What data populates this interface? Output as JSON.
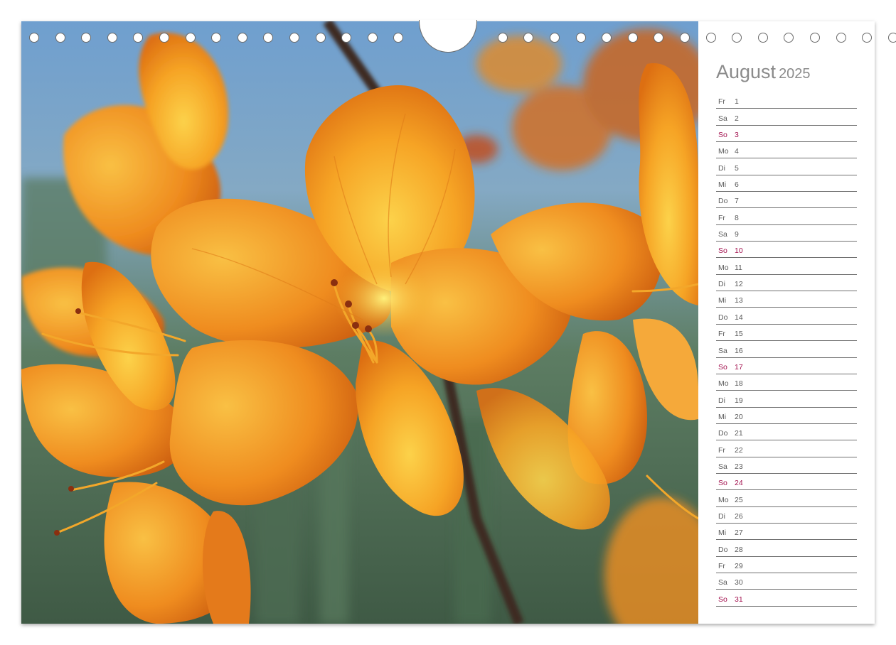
{
  "calendar": {
    "month": "August",
    "year": "2025",
    "days": [
      {
        "weekday": "Fr",
        "day": "1",
        "sunday": false
      },
      {
        "weekday": "Sa",
        "day": "2",
        "sunday": false
      },
      {
        "weekday": "So",
        "day": "3",
        "sunday": true
      },
      {
        "weekday": "Mo",
        "day": "4",
        "sunday": false
      },
      {
        "weekday": "Di",
        "day": "5",
        "sunday": false
      },
      {
        "weekday": "Mi",
        "day": "6",
        "sunday": false
      },
      {
        "weekday": "Do",
        "day": "7",
        "sunday": false
      },
      {
        "weekday": "Fr",
        "day": "8",
        "sunday": false
      },
      {
        "weekday": "Sa",
        "day": "9",
        "sunday": false
      },
      {
        "weekday": "So",
        "day": "10",
        "sunday": true
      },
      {
        "weekday": "Mo",
        "day": "11",
        "sunday": false
      },
      {
        "weekday": "Di",
        "day": "12",
        "sunday": false
      },
      {
        "weekday": "Mi",
        "day": "13",
        "sunday": false
      },
      {
        "weekday": "Do",
        "day": "14",
        "sunday": false
      },
      {
        "weekday": "Fr",
        "day": "15",
        "sunday": false
      },
      {
        "weekday": "Sa",
        "day": "16",
        "sunday": false
      },
      {
        "weekday": "So",
        "day": "17",
        "sunday": true
      },
      {
        "weekday": "Mo",
        "day": "18",
        "sunday": false
      },
      {
        "weekday": "Di",
        "day": "19",
        "sunday": false
      },
      {
        "weekday": "Mi",
        "day": "20",
        "sunday": false
      },
      {
        "weekday": "Do",
        "day": "21",
        "sunday": false
      },
      {
        "weekday": "Fr",
        "day": "22",
        "sunday": false
      },
      {
        "weekday": "Sa",
        "day": "23",
        "sunday": false
      },
      {
        "weekday": "So",
        "day": "24",
        "sunday": true
      },
      {
        "weekday": "Mo",
        "day": "25",
        "sunday": false
      },
      {
        "weekday": "Di",
        "day": "26",
        "sunday": false
      },
      {
        "weekday": "Mi",
        "day": "27",
        "sunday": false
      },
      {
        "weekday": "Do",
        "day": "28",
        "sunday": false
      },
      {
        "weekday": "Fr",
        "day": "29",
        "sunday": false
      },
      {
        "weekday": "Sa",
        "day": "30",
        "sunday": false
      },
      {
        "weekday": "So",
        "day": "31",
        "sunday": true
      }
    ]
  },
  "colors": {
    "sunday": "#a3124f",
    "weekday": "#5a5a5a",
    "title": "#8b8b8b",
    "petal_orange": "#f08a1c",
    "petal_yellow": "#f7b92e",
    "sky": "#7fb0d8"
  },
  "binding": {
    "hole_count": 32,
    "hanger": "wire-hanger-cutout"
  }
}
